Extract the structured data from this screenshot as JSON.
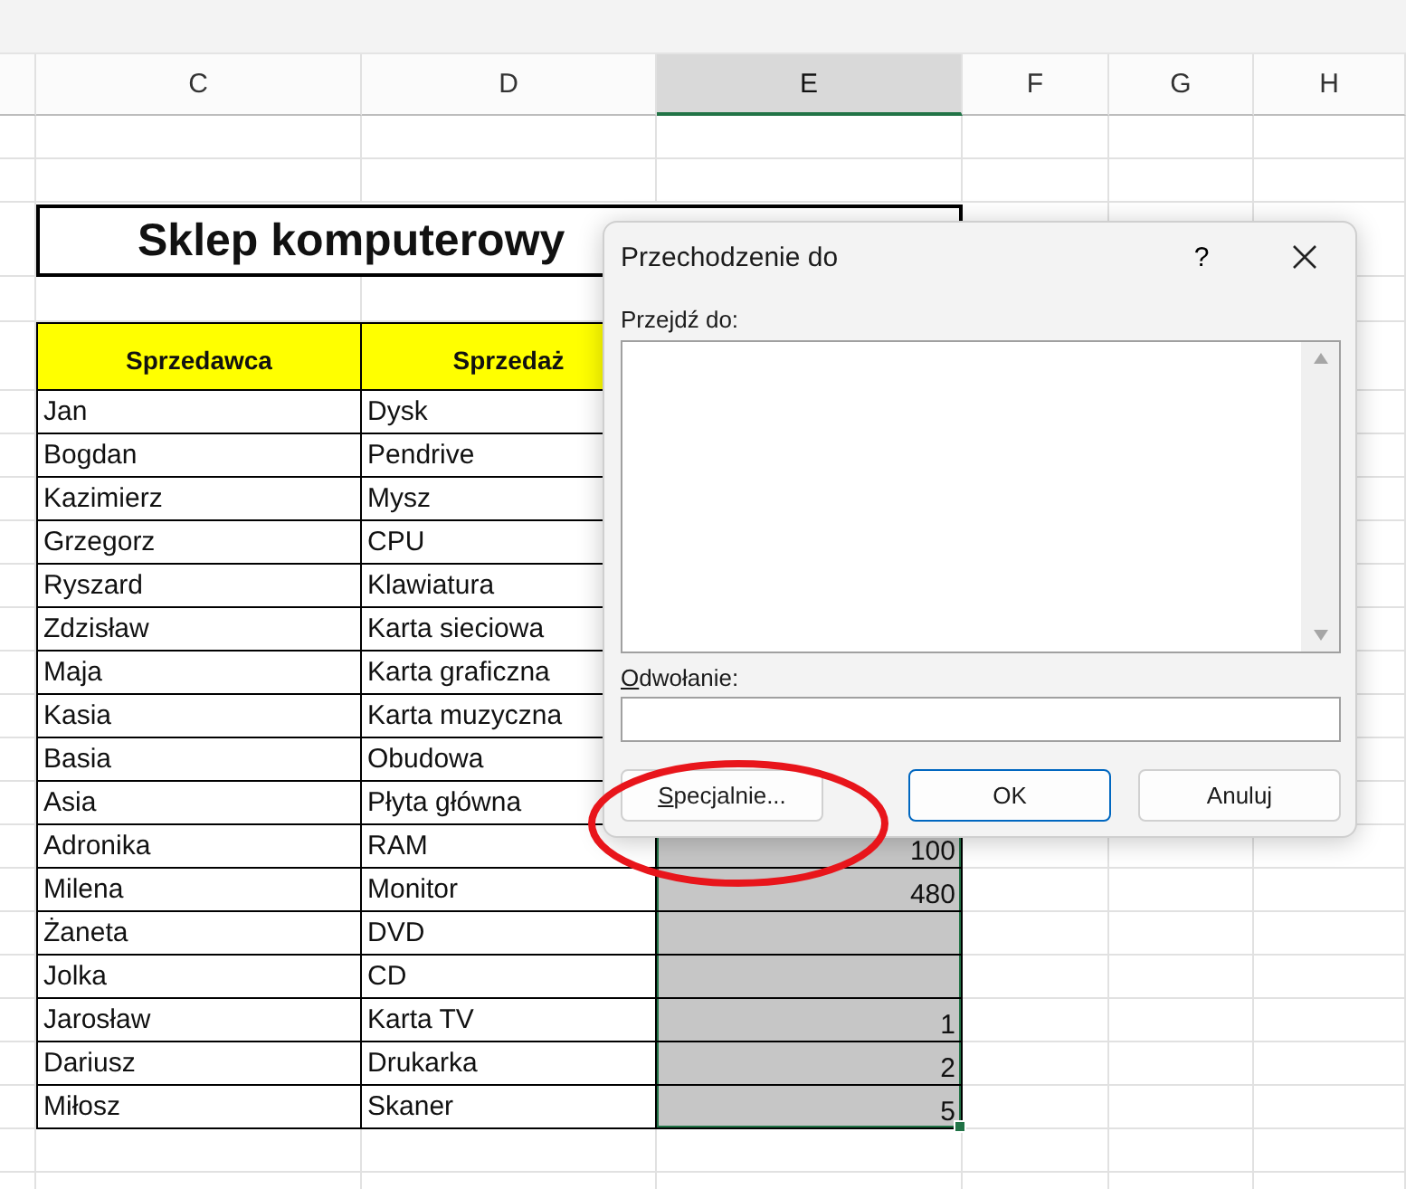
{
  "column_headers": [
    {
      "label": "C",
      "selected": false
    },
    {
      "label": "D",
      "selected": false
    },
    {
      "label": "E",
      "selected": true
    },
    {
      "label": "F",
      "selected": false
    },
    {
      "label": "G",
      "selected": false
    },
    {
      "label": "H",
      "selected": false
    }
  ],
  "title": "Sklep komputerowy",
  "table": {
    "columns": [
      "Sprzedawca",
      "Sprzedaż"
    ],
    "rows": [
      {
        "seller": "Jan",
        "item": "Dysk"
      },
      {
        "seller": "Bogdan",
        "item": "Pendrive"
      },
      {
        "seller": "Kazimierz",
        "item": "Mysz"
      },
      {
        "seller": "Grzegorz",
        "item": "CPU"
      },
      {
        "seller": "Ryszard",
        "item": "Klawiatura"
      },
      {
        "seller": "Zdzisław",
        "item": "Karta sieciowa"
      },
      {
        "seller": "Maja",
        "item": "Karta graficzna"
      },
      {
        "seller": "Kasia",
        "item": "Karta muzyczna"
      },
      {
        "seller": "Basia",
        "item": "Obudowa"
      },
      {
        "seller": "Asia",
        "item": "Płyta główna"
      },
      {
        "seller": "Adronika",
        "item": "RAM",
        "value": "100"
      },
      {
        "seller": "Milena",
        "item": "Monitor",
        "value": "480"
      },
      {
        "seller": "Żaneta",
        "item": "DVD"
      },
      {
        "seller": "Jolka",
        "item": "CD"
      },
      {
        "seller": "Jarosław",
        "item": "Karta TV",
        "value": "1"
      },
      {
        "seller": "Dariusz",
        "item": "Drukarka",
        "value": "2"
      },
      {
        "seller": "Miłosz",
        "item": "Skaner",
        "value": "5"
      }
    ]
  },
  "dialog": {
    "title": "Przechodzenie do",
    "help": "?",
    "goto_label": "Przejdź do:",
    "reference_label": "Odwołanie:",
    "buttons": [
      {
        "label": "Specjalnie...",
        "kind": "plain"
      },
      {
        "label": "OK",
        "kind": "default"
      },
      {
        "label": "Anuluj",
        "kind": "plain"
      }
    ]
  }
}
